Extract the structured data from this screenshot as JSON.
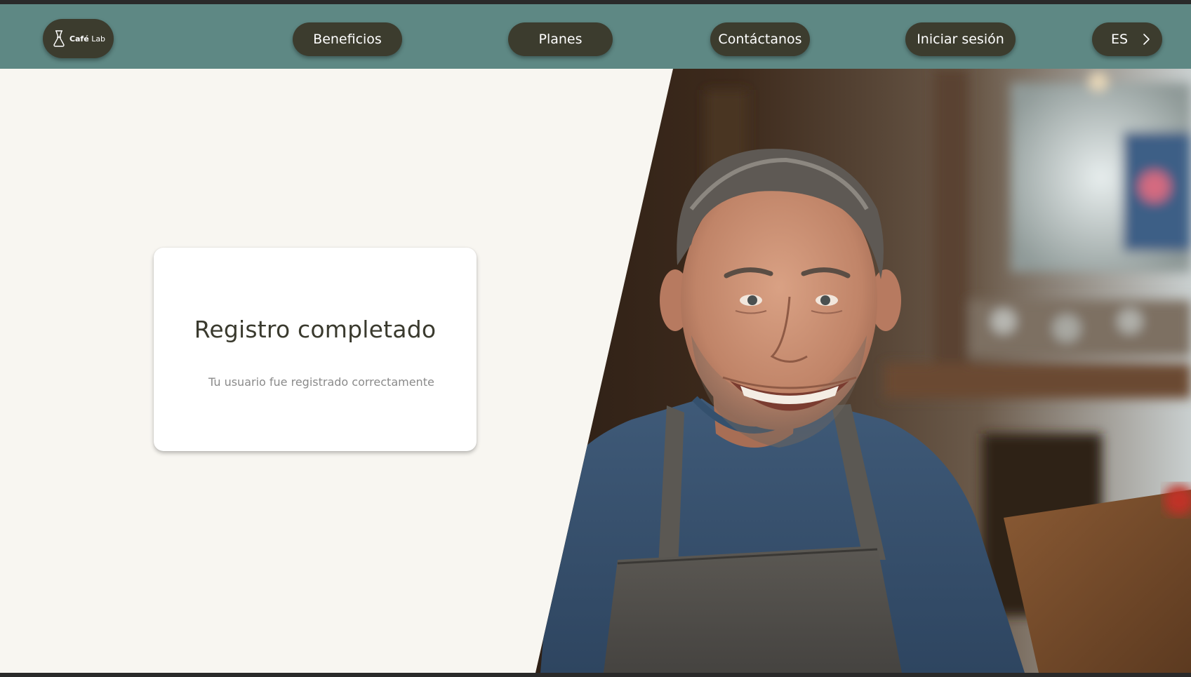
{
  "nav": {
    "logo": {
      "strong": "Café",
      "rest": "Lab",
      "icon": "chemex-coffee-icon"
    },
    "links": {
      "benefits": "Beneficios",
      "plans": "Planes",
      "contact": "Contáctanos",
      "login": "Iniciar sesión"
    },
    "language": {
      "label": "ES",
      "icon": "chevron-right-icon"
    }
  },
  "card": {
    "title": "Registro completado",
    "message": "Tu usuario fue registrado correctamente"
  },
  "hero_image": {
    "subject": "smiling-barista-photo"
  },
  "colors": {
    "navbar": "#5e8884",
    "pill": "#3c3c2e",
    "background": "#f8f6f1",
    "card": "#ffffff",
    "title": "#3a3a2e",
    "message": "#8a8a8a"
  }
}
